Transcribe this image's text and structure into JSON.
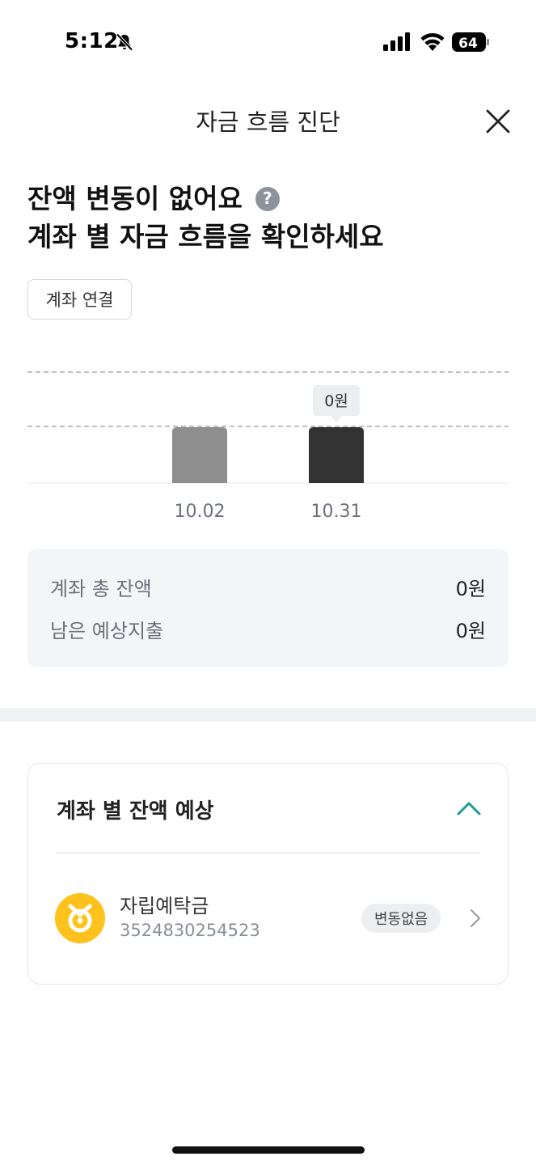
{
  "status_bar": {
    "time": "5:12",
    "battery": "64"
  },
  "header": {
    "title": "자금 흐름 진단"
  },
  "headline": {
    "line1": "잔액 변동이 없어요",
    "line2": "계좌 별 자금 흐름을 확인하세요",
    "help_symbol": "?"
  },
  "connect_button": {
    "label": "계좌 연결"
  },
  "chart_data": {
    "type": "bar",
    "categories": [
      "10.02",
      "10.31"
    ],
    "values": [
      0,
      0
    ],
    "tooltip": "0원",
    "highlight_index": 1,
    "colors": {
      "past": "#8e8e8e",
      "current": "#333333",
      "tooltip_bg": "#eceef0",
      "grid": "#9a9a9a"
    }
  },
  "summary": {
    "rows": [
      {
        "label": "계좌 총 잔액",
        "value": "0원"
      },
      {
        "label": "남은 예상지출",
        "value": "0원"
      }
    ]
  },
  "accounts_card": {
    "title": "계좌 별 잔액 예상",
    "accent_color": "#1a9b96",
    "items": [
      {
        "name": "자립예탁금",
        "number": "3524830254523",
        "badge": "변동없음",
        "icon": "bank-logo-icon",
        "logo_color": "#ffc21c"
      }
    ]
  }
}
